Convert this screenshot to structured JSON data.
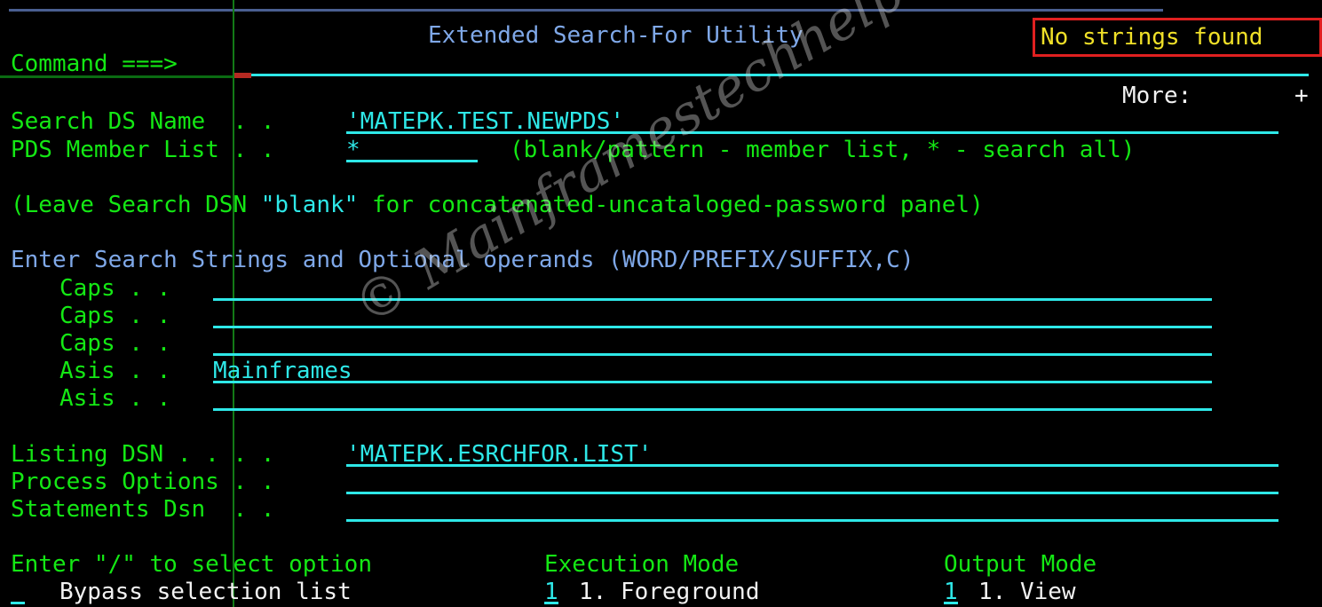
{
  "screen": {
    "title": "Extended Search-For Utility",
    "message": "No strings found",
    "command_label": "Command ===>",
    "command_value": "",
    "more_label": "More:",
    "more_value": "+"
  },
  "watermark": {
    "text": "© Mainframestechhelp"
  },
  "fields": {
    "search_ds_name": {
      "label": "Search DS Name  . .",
      "value": "'MATEPK.TEST.NEWPDS'"
    },
    "pds_member_list": {
      "label": "PDS Member List . .",
      "value": "*",
      "hint": "(blank/pattern - member list, * - search all)"
    },
    "listing_dsn": {
      "label": "Listing DSN . . . .",
      "value": "'MATEPK.ESRCHFOR.LIST'"
    },
    "process_options": {
      "label": "Process Options . .",
      "value": ""
    },
    "statements_dsn": {
      "label": "Statements Dsn  . .",
      "value": ""
    }
  },
  "notes": {
    "leave_blank_pre": "(Leave Search DSN ",
    "leave_blank_quoted": "\"blank\"",
    "leave_blank_post": " for concatenated-uncataloged-password panel)",
    "enter_strings": "Enter Search Strings and Optional operands ",
    "enter_strings_operands": "(WORD/PREFIX/SUFFIX,C)"
  },
  "search_strings": [
    {
      "label": "Caps . .",
      "value": ""
    },
    {
      "label": "Caps . .",
      "value": ""
    },
    {
      "label": "Caps . .",
      "value": ""
    },
    {
      "label": "Asis . .",
      "value": "Mainframes"
    },
    {
      "label": "Asis . .",
      "value": ""
    }
  ],
  "options": {
    "select_header": "Enter \"/\" to select option",
    "bypass_label": "Bypass selection list",
    "bypass_value": "_",
    "execution_mode": {
      "header": "Execution Mode",
      "value": "1",
      "option_1": "1. Foreground"
    },
    "output_mode": {
      "header": "Output Mode",
      "value": "1",
      "option_1": "1. View"
    }
  },
  "colors": {
    "green": "#14e814",
    "cyan": "#2ee8e8",
    "white": "#f2f2f2",
    "blue": "#7fa8e8",
    "yellow": "#f0e028",
    "message_border": "#e02020",
    "background": "#000000"
  }
}
